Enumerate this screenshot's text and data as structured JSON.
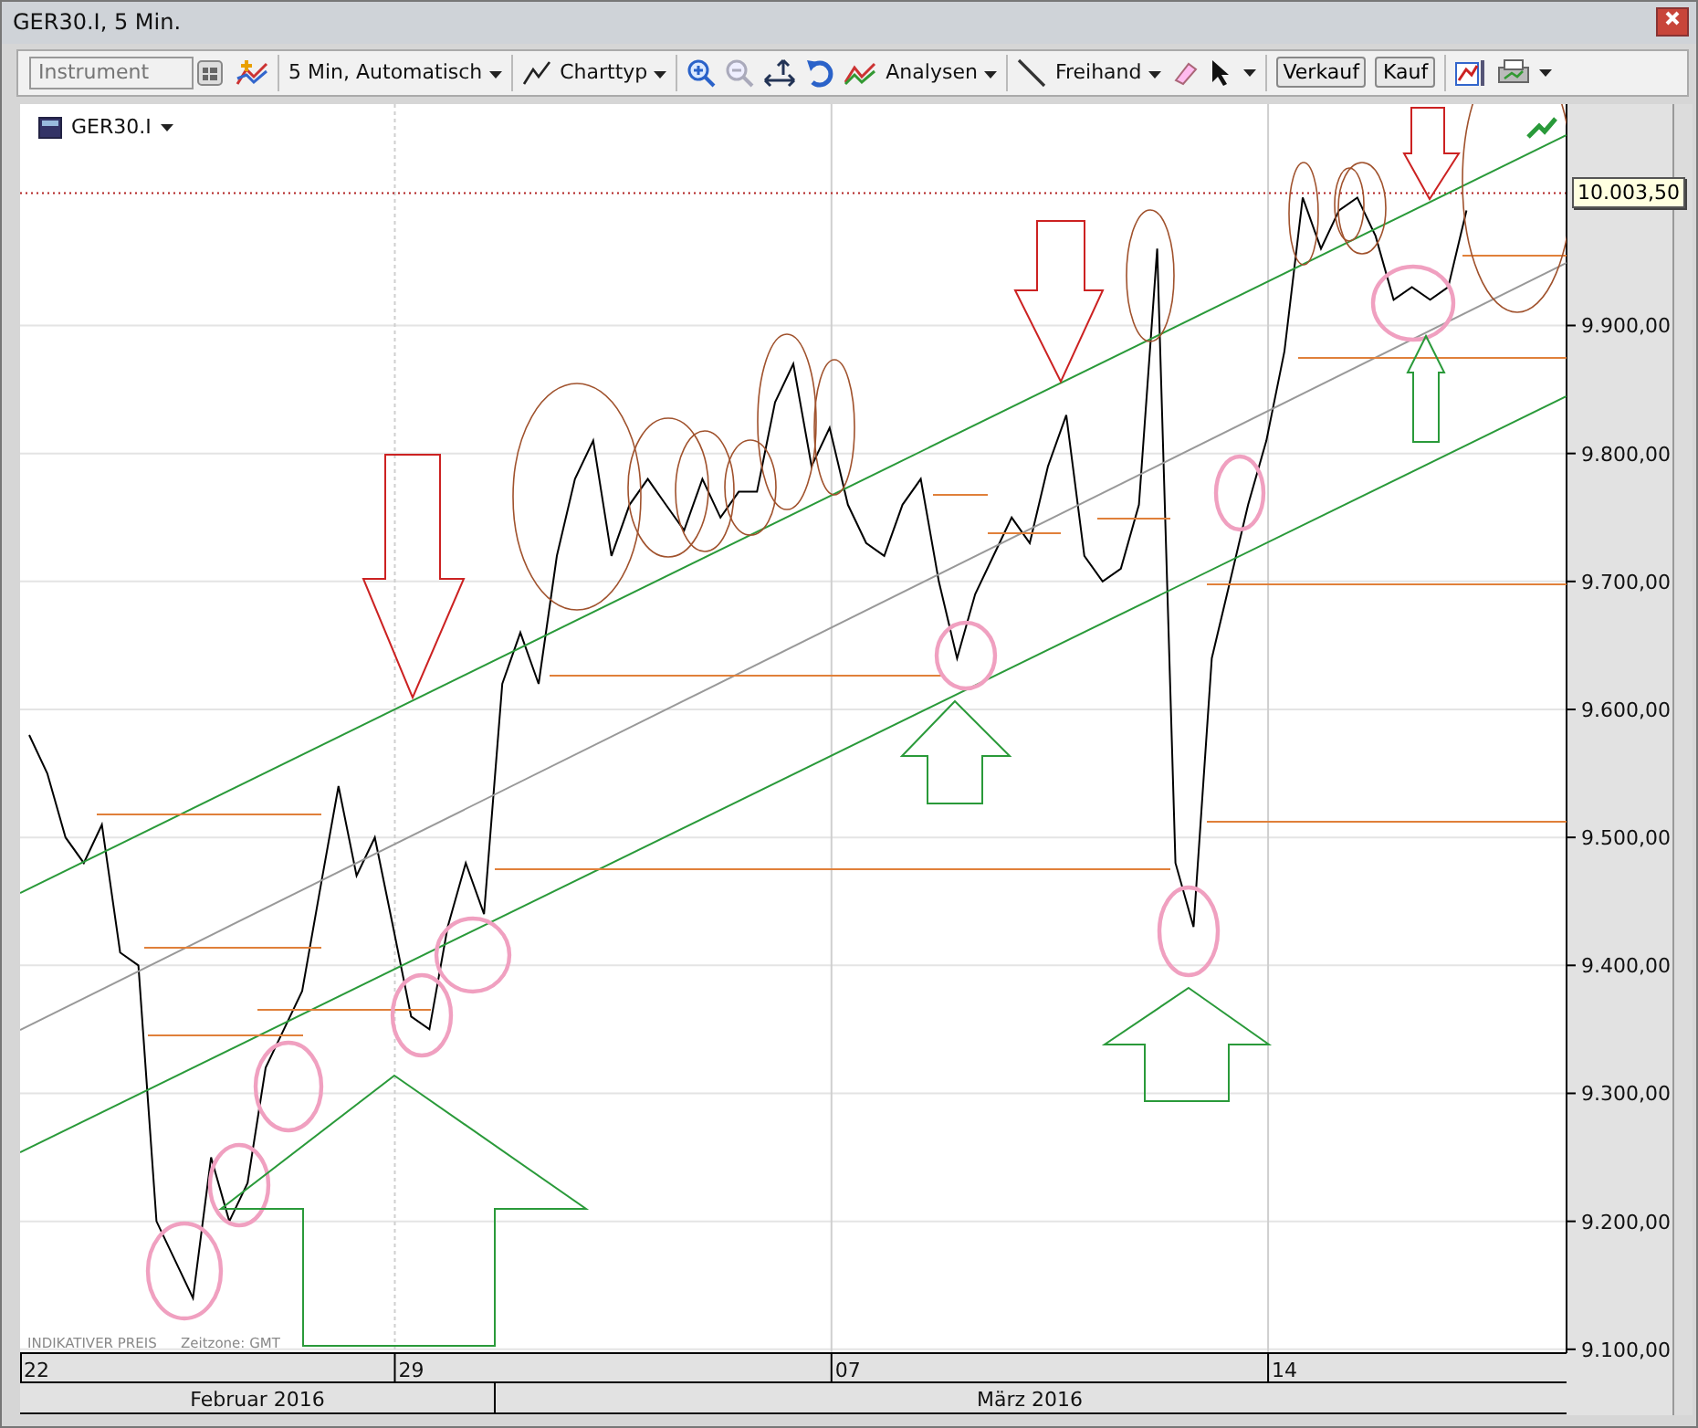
{
  "window": {
    "title": "GER30.I, 5 Min."
  },
  "toolbar": {
    "instrument_field": {
      "placeholder": "Instrument"
    },
    "interval": "5 Min,  Automatisch",
    "chart_type": "Charttyp",
    "analyses": "Analysen",
    "freehand": "Freihand",
    "sell": "Verkauf",
    "buy": "Kauf"
  },
  "chart": {
    "instrument": "GER30.I",
    "price_label": "10.003,50",
    "footer_note": "INDIKATIVER PREIS",
    "timezone": "Zeitzone: GMT",
    "months": [
      "Februar 2016",
      "März 2016"
    ],
    "chart_data": {
      "type": "line",
      "grid": true,
      "categories": [
        "22",
        null,
        null,
        null,
        null,
        null,
        null,
        null,
        null,
        null,
        null,
        null,
        null,
        null,
        null,
        null,
        null,
        null,
        null,
        null,
        null,
        "29",
        null,
        null,
        null,
        null,
        null,
        null,
        null,
        null,
        null,
        null,
        null,
        null,
        null,
        null,
        null,
        null,
        null,
        null,
        null,
        null,
        null,
        null,
        null,
        "07",
        null,
        null,
        null,
        null,
        null,
        null,
        null,
        null,
        null,
        null,
        null,
        null,
        null,
        null,
        null,
        null,
        null,
        null,
        null,
        null,
        null,
        null,
        null,
        "14",
        null,
        null,
        null,
        null,
        null,
        null,
        null,
        null,
        null,
        null,
        null,
        null,
        null,
        null,
        null
      ],
      "ylim": [
        9097,
        10073
      ],
      "ref_lines": [
        {
          "axis": "y",
          "value": 10003.5,
          "color": "#b22222"
        }
      ],
      "yticks": [
        {
          "value": 9100,
          "label": "9.100,00"
        },
        {
          "value": 9200,
          "label": "9.200,00"
        },
        {
          "value": 9300,
          "label": "9.300,00"
        },
        {
          "value": 9400,
          "label": "9.400,00"
        },
        {
          "value": 9500,
          "label": "9.500,00"
        },
        {
          "value": 9600,
          "label": "9.600,00"
        },
        {
          "value": 9700,
          "label": "9.700,00"
        },
        {
          "value": 9800,
          "label": "9.800,00"
        },
        {
          "value": 9900,
          "label": "9.900,00"
        }
      ],
      "series": [
        {
          "color": "#000000",
          "values": [
            9580,
            9550,
            9500,
            9480,
            9510,
            9410,
            9400,
            9200,
            9170,
            9140,
            9250,
            9200,
            9230,
            9320,
            9350,
            9380,
            9460,
            9540,
            9470,
            9500,
            9430,
            9360,
            9350,
            9430,
            9480,
            9440,
            9620,
            9660,
            9620,
            9720,
            9780,
            9810,
            9720,
            9760,
            9780,
            9760,
            9740,
            9780,
            9750,
            9770,
            9770,
            9840,
            9870,
            9790,
            9820,
            9760,
            9730,
            9720,
            9760,
            9780,
            9700,
            9640,
            9690,
            9720,
            9750,
            9730,
            9790,
            9830,
            9720,
            9700,
            9710,
            9760,
            9960,
            9480,
            9430,
            9640,
            9700,
            9760,
            9810,
            9880,
            10000,
            9960,
            9990,
            10000,
            9970,
            9920,
            9930,
            9920,
            9930,
            9990,
            null,
            null,
            null,
            null,
            null
          ]
        }
      ]
    }
  }
}
